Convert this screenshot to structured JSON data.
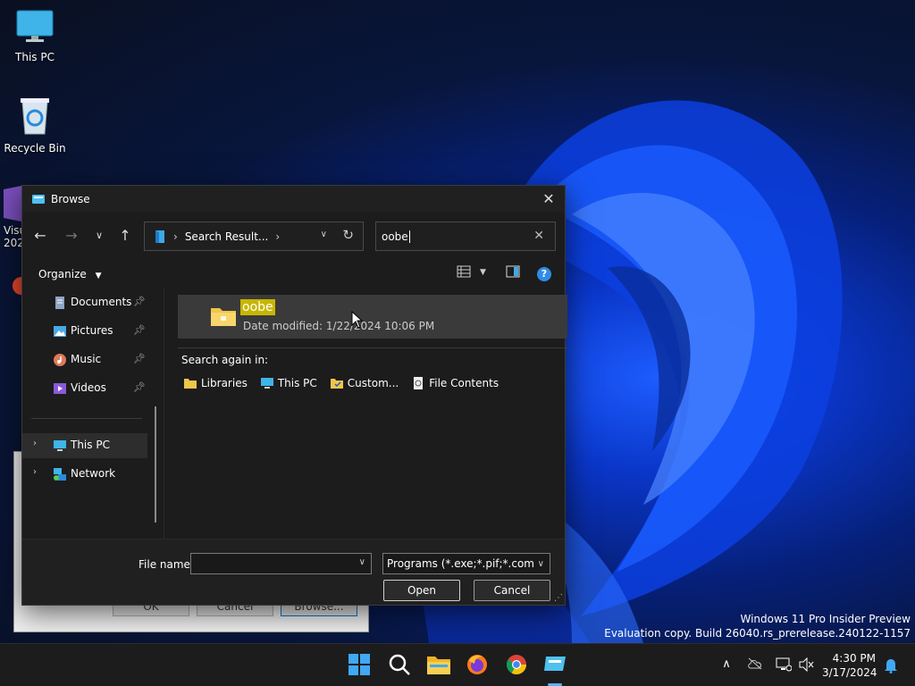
{
  "desktop": {
    "icons": [
      {
        "label": "This PC"
      },
      {
        "label": "Recycle Bin"
      },
      {
        "label": "Visu\n202"
      }
    ]
  },
  "background_dialog": {
    "ok_label": "OK",
    "cancel_label": "Cancel",
    "browse_label": "Browse..."
  },
  "dialog": {
    "title": "Browse",
    "address": {
      "crumb": "Search Result...",
      "separator": "›"
    },
    "search": {
      "value": "oobe"
    },
    "organize_label": "Organize",
    "nav_pane": {
      "quick_access": [
        {
          "label": "Documents",
          "icon": "documents-icon"
        },
        {
          "label": "Pictures",
          "icon": "pictures-icon"
        },
        {
          "label": "Music",
          "icon": "music-icon"
        },
        {
          "label": "Videos",
          "icon": "videos-icon"
        }
      ],
      "this_pc_label": "This PC",
      "network_label": "Network"
    },
    "result": {
      "name": "oobe",
      "meta": "Date modified: 1/22/2024 10:06 PM"
    },
    "search_again_label": "Search again in:",
    "search_again_items": [
      {
        "label": "Libraries"
      },
      {
        "label": "This PC"
      },
      {
        "label": "Custom..."
      },
      {
        "label": "File Contents"
      }
    ],
    "file_name_label": "File name:",
    "file_name_value": "",
    "file_type": "Programs (*.exe;*.pif;*.com;*.bat)",
    "open_label": "Open",
    "cancel_label": "Cancel"
  },
  "watermark": {
    "line1": "Windows 11 Pro Insider Preview",
    "line2": "Evaluation copy. Build 26040.rs_prerelease.240122-1157"
  },
  "taskbar": {
    "time": "4:30 PM",
    "date": "3/17/2024"
  },
  "colors": {
    "accent": "#2e8de6",
    "highlight": "#c7b600"
  }
}
